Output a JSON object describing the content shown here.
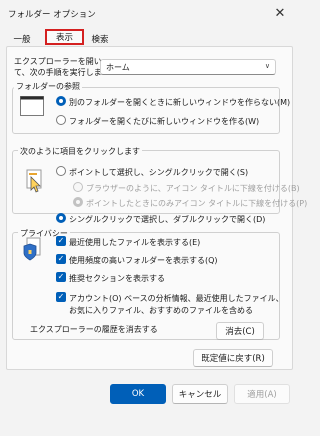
{
  "window": {
    "title": "フォルダー オプション",
    "close_glyph": "✕"
  },
  "tabs": [
    {
      "label": "一般"
    },
    {
      "label": "表示"
    },
    {
      "label": "検索"
    }
  ],
  "startup": {
    "label_line1": "エクスプローラーを開い",
    "label_line2": "て、次の手順を実行しま",
    "dropdown_value": "ホーム",
    "dropdown_chevron": "∨"
  },
  "browse_folders": {
    "heading": "フォルダーの参照",
    "option_same": "別のフォルダーを開くときに新しいウィンドウを作らない(M)",
    "option_new": "フォルダーを開くたびに新しいウィンドウを作る(W)"
  },
  "click_items": {
    "heading": "次のように項目をクリックします",
    "option_single": "ポイントして選択し、シングルクリックで開く(S)",
    "sub_browser": "ブラウザーのように、アイコン タイトルに下線を付ける(B)",
    "sub_point": "ポイントしたときにのみアイコン タイトルに下線を付ける(P)",
    "option_double": "シングルクリックで選択し、ダブルクリックで開く(D)"
  },
  "privacy": {
    "heading": "プライバシー",
    "recent_files": "最近使用したファイルを表示する(E)",
    "frequent_folders": "使用頻度の高いフォルダーを表示する(Q)",
    "recommended": "推奨セクションを表示する",
    "account_line1": "アカウント(O) ベースの分析情報、最近使用したファイル、",
    "account_line2": "お気に入りファイル、おすすめのファイルを含める",
    "clear_history_label": "エクスプローラーの履歴を消去する",
    "clear_button": "消去(C)",
    "check_glyph": "✓"
  },
  "restore_defaults": "既定値に戻す(R)",
  "footer": {
    "ok": "OK",
    "cancel": "キャンセル",
    "apply": "適用(A)"
  },
  "colors": {
    "accent": "#005fb8",
    "tab_highlight": "#d42020"
  }
}
